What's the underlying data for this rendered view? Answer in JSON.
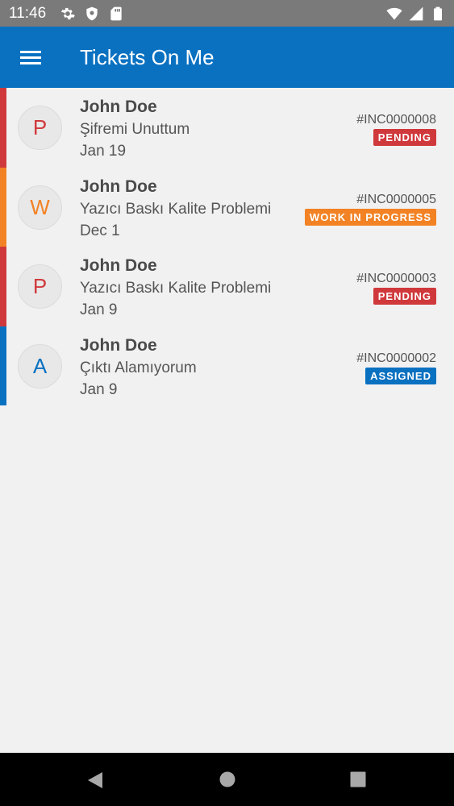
{
  "status_bar": {
    "time": "11:46",
    "left_icons": [
      "gear-icon",
      "shield-icon",
      "sd-card-icon"
    ],
    "right_icons": [
      "wifi-icon",
      "signal-icon",
      "battery-icon"
    ]
  },
  "app_bar": {
    "menu_icon": "hamburger-menu-icon",
    "title": "Tickets On Me",
    "color": "#0a71c1"
  },
  "tickets": [
    {
      "initial": "P",
      "name": "John Doe",
      "subject": "Şifremi Unuttum",
      "date": "Jan 19",
      "number": "#INC0000008",
      "status": "PENDING",
      "color": "#d0393c"
    },
    {
      "initial": "W",
      "name": "John Doe",
      "subject": "Yazıcı Baskı Kalite Problemi",
      "date": "Dec  1",
      "number": "#INC0000005",
      "status": "WORK IN PROGRESS",
      "color": "#f28224"
    },
    {
      "initial": "P",
      "name": "John Doe",
      "subject": "Yazıcı Baskı Kalite Problemi",
      "date": "Jan  9",
      "number": "#INC0000003",
      "status": "PENDING",
      "color": "#d0393c"
    },
    {
      "initial": "A",
      "name": "John Doe",
      "subject": "Çıktı Alamıyorum",
      "date": "Jan  9",
      "number": "#INC0000002",
      "status": "ASSIGNED",
      "color": "#0a71c1"
    }
  ],
  "nav_bar": {
    "buttons": [
      "back-icon",
      "home-icon",
      "recents-icon"
    ]
  }
}
